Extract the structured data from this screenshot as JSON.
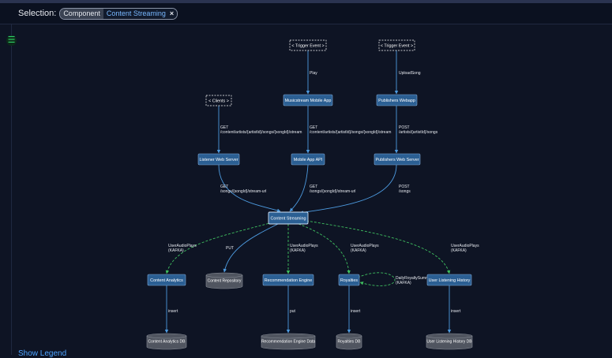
{
  "header": {
    "selection_label": "Selection:",
    "chip_type": "Component",
    "chip_value": "Content Streaming",
    "chip_close": "×"
  },
  "menu_icon": "☰",
  "show_legend": "Show Legend",
  "colors": {
    "background": "#0e1424",
    "node_fill": "#2b5f93",
    "sync_edge": "#4d9be0",
    "async_edge": "#3fc060",
    "db_fill": "#505560",
    "accent": "#79b8ff"
  },
  "nodes": {
    "trigger1": "< Trigger Event >",
    "trigger2": "< Trigger Event >",
    "clients": "< Clients >",
    "mobile_app": "Musicstream Mobile App",
    "webapp": "Publishers Webapp",
    "listener": "Listener Web Server",
    "mobile_api": "Mobile App API",
    "pub_server": "Publishers Web Server",
    "content_streaming": "Content Streaming",
    "content_analytics": "Content Analytics",
    "content_repo": "Content Repository",
    "rec_engine": "Recommendation Engine",
    "royalties": "Royalties",
    "history": "User Listening History",
    "analytics_db": "Content Analytics DB",
    "rec_db": "Recommendation Engine Data",
    "royalties_db": "Royalties DB",
    "history_db": "User Listening History DB"
  },
  "edges": {
    "play": "Play",
    "upload": "UploadSong",
    "get1_a": "GET",
    "get1_b": "/content/artists/{artistId}/songs/{songId}/stream",
    "get2_a": "GET",
    "get2_b": "/content/artists/{artistId}/songs/{songId}/stream",
    "post1_a": "POST",
    "post1_b": "/artists/{artistId}/songs",
    "get3_a": "GET",
    "get3_b": "/songs/{songId}/stream-url",
    "get4_a": "GET",
    "get4_b": "/songs/{songId}/stream-url",
    "post2_a": "POST",
    "post2_b": "/songs",
    "uap1_a": "UserAudioPlays",
    "uap1_b": "(KAFKA)",
    "put1": "PUT",
    "uap2_a": "UserAudioPlays",
    "uap2_b": "(KAFKA)",
    "uap3_a": "UserAudioPlays",
    "uap3_b": "(KAFKA)",
    "uap4_a": "UserAudioPlays",
    "uap4_b": "(KAFKA)",
    "drs_a": "DailyRoyaltySumm",
    "drs_b": "(KAFKA)",
    "insert1": "insert",
    "put2": "put",
    "insert2": "insert",
    "insert3": "insert"
  }
}
